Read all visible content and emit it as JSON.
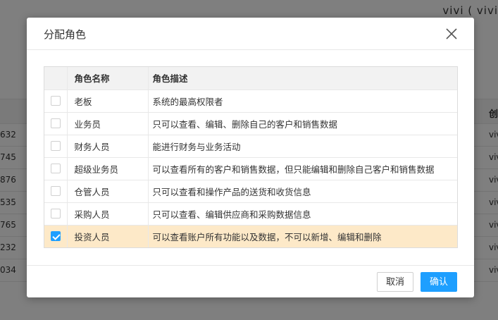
{
  "background": {
    "user_label": "vivi ( vivi",
    "header_cell": "创",
    "rows": [
      {
        "num": "632",
        "right": "viv"
      },
      {
        "num": "745",
        "right": "viv"
      },
      {
        "num": "876",
        "right": "viv"
      },
      {
        "num": "535",
        "right": "viv"
      },
      {
        "num": "765",
        "right": "viv"
      },
      {
        "num": "232",
        "right": "viv"
      },
      {
        "num": "034",
        "right": "viv"
      }
    ]
  },
  "dialog": {
    "title": "分配角色",
    "close_icon": "close-icon",
    "table": {
      "headers": {
        "name": "角色名称",
        "desc": "角色描述"
      },
      "rows": [
        {
          "name": "老板",
          "desc": "系统的最高权限者",
          "checked": false
        },
        {
          "name": "业务员",
          "desc": "只可以查看、编辑、删除自己的客户和销售数据",
          "checked": false
        },
        {
          "name": "财务人员",
          "desc": "能进行财务与业务活动",
          "checked": false
        },
        {
          "name": "超级业务员",
          "desc": "可以查看所有的客户和销售数据，但只能编辑和删除自己客户和销售数据",
          "checked": false
        },
        {
          "name": "仓管人员",
          "desc": "只可以查看和操作产品的送货和收货信息",
          "checked": false
        },
        {
          "name": "采购人员",
          "desc": "只可以查看、编辑供应商和采购数据信息",
          "checked": false
        },
        {
          "name": "投资人员",
          "desc": "可以查看账户所有功能以及数据，不可以新增、编辑和删除",
          "checked": true
        }
      ]
    },
    "footer": {
      "cancel_label": "取消",
      "ok_label": "确认"
    },
    "colors": {
      "accent": "#1e9fff",
      "selected_row": "#fde9c8"
    }
  }
}
